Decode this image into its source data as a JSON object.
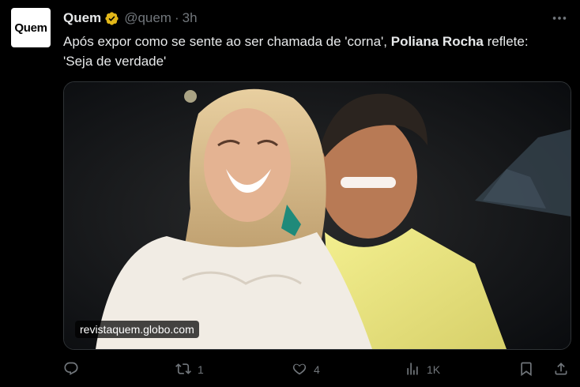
{
  "author": {
    "avatar_text": "Quem",
    "name": "Quem",
    "handle": "@quem",
    "separator": "·",
    "time": "3h",
    "verified_badge_color": "#e2b719"
  },
  "tweet": {
    "text_part1": "Após expor como se sente ao ser chamada de 'corna', ",
    "text_bold": "Poliana Rocha",
    "text_part2": " reflete: 'Seja de verdade'"
  },
  "media": {
    "source": "revistaquem.globo.com",
    "description_icon": "photo-couple-smiling"
  },
  "actions": {
    "reply_count": "",
    "retweet_count": "1",
    "like_count": "4",
    "views_count": "1K"
  },
  "icons": {
    "more": "more-horizontal-icon",
    "reply": "reply-icon",
    "retweet": "retweet-icon",
    "like": "heart-icon",
    "views": "views-icon",
    "bookmark": "bookmark-icon",
    "share": "share-icon"
  },
  "colors": {
    "background": "#000000",
    "text": "#e7e9ea",
    "muted": "#71767b"
  }
}
